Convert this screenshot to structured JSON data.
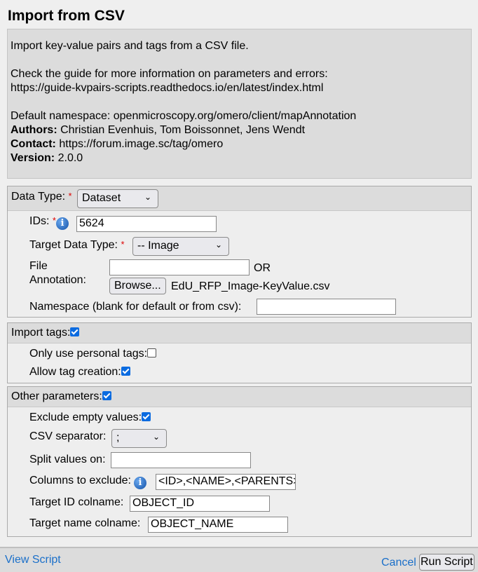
{
  "title": "Import from CSV",
  "description": {
    "intro": "Import key-value pairs and tags from a CSV file.",
    "guide_text": "Check the guide for more information on parameters and errors:",
    "guide_url": "https://guide-kvpairs-scripts.readthedocs.io/en/latest/index.html",
    "namespace": "Default namespace: openmicroscopy.org/omero/client/mapAnnotation",
    "authors_label": "Authors:",
    "authors": "Christian Evenhuis, Tom Boissonnet, Jens Wendt",
    "contact_label": "Contact:",
    "contact": "https://forum.image.sc/tag/omero",
    "version_label": "Version:",
    "version": "2.0.0"
  },
  "data_section": {
    "data_type_label": "Data Type:",
    "data_type_value": "Dataset",
    "ids_label": "IDs:",
    "ids_value": "5624",
    "target_type_label": "Target Data Type:",
    "target_type_value": "-- Image",
    "file_label_1": "File",
    "file_label_2": "Annotation:",
    "file_value": "",
    "or_label": "OR",
    "browse_label": "Browse...",
    "file_name": "EdU_RFP_Image-KeyValue.csv",
    "namespace_label": "Namespace (blank for default or from csv):",
    "namespace_value": ""
  },
  "tags_section": {
    "header": "Import tags:",
    "header_checked": true,
    "personal_label": "Only use personal tags:",
    "personal_checked": false,
    "creation_label": "Allow tag creation:",
    "creation_checked": true
  },
  "other_section": {
    "header": "Other parameters:",
    "header_checked": true,
    "exclude_empty_label": "Exclude empty values:",
    "exclude_empty_checked": true,
    "separator_label": "CSV separator:",
    "separator_value": ";",
    "split_label": "Split values on:",
    "split_value": "",
    "columns_label": "Columns to exclude:",
    "columns_value": "<ID>,<NAME>,<PARENTS>",
    "target_id_label": "Target ID colname:",
    "target_id_value": "OBJECT_ID",
    "target_name_label": "Target name colname:",
    "target_name_value": "OBJECT_NAME"
  },
  "footer": {
    "view_script": "View Script",
    "cancel": "Cancel",
    "run_script": "Run Script"
  },
  "colors": {
    "link": "#1a6fc9",
    "required": "#dd0000",
    "checkbox": "#0b6be0"
  }
}
